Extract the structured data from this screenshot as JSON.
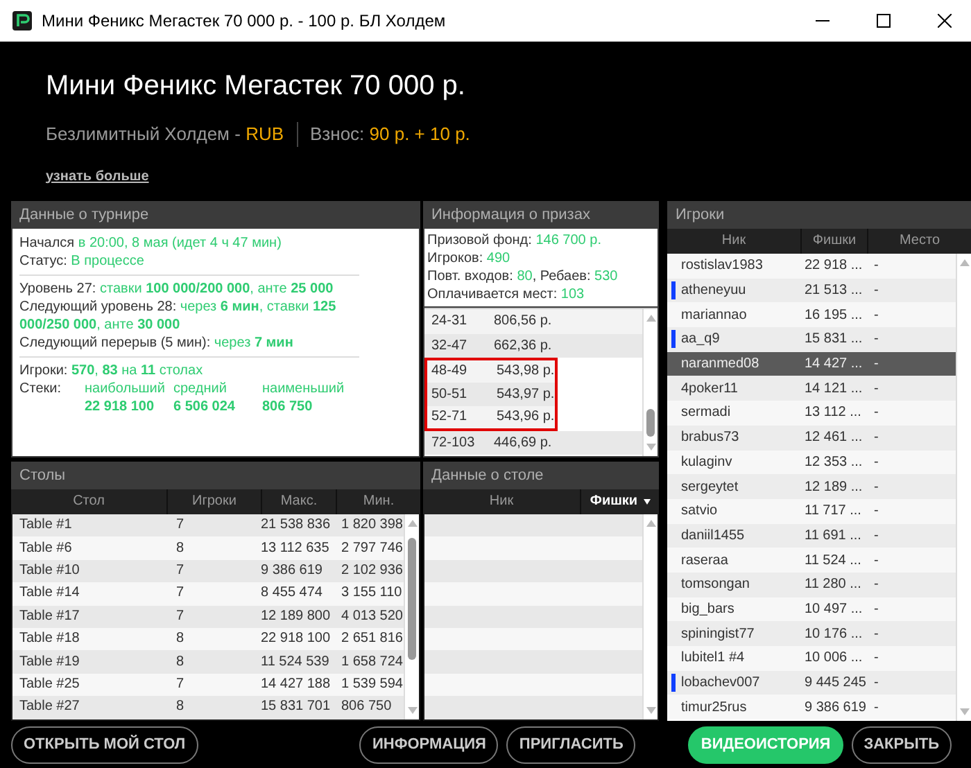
{
  "window": {
    "title": "Мини Феникс Мегастек 70 000 р. - 100 р. БЛ Холдем"
  },
  "header": {
    "title": "Мини Феникс Мегастек 70 000 р.",
    "game": "Безлимитный Холдем - ",
    "currency": "RUB",
    "fee_label": "Взнос: ",
    "fee": "90 р. + 10 р.",
    "more_link": "узнать больше"
  },
  "tournament": {
    "title": "Данные о турнире",
    "groups": [
      [
        {
          "label": "Начался ",
          "value": "в 20:00, 8 мая (идет 4 ч 47 мин)"
        },
        {
          "label": "Статус: ",
          "value": "В процессе"
        }
      ],
      [
        {
          "label": "Уровень 27: ",
          "value": "ставки **100 000/200 000**, анте **25 000**"
        },
        {
          "label": "Следующий уровень 28: ",
          "value": "через **6 мин**, ставки **125 000/250 000**, анте **30 000**"
        },
        {
          "label": "Следующий перерыв (5 мин): ",
          "value": "через **7 мин**"
        }
      ],
      [
        {
          "label": "Игроки: ",
          "value": "**570**, **83** на **11** столах"
        }
      ]
    ],
    "stacks_label": "Стеки:",
    "stacks": [
      {
        "name": "наибольший",
        "value": "22 918 100"
      },
      {
        "name": "средний",
        "value": "6 506 024"
      },
      {
        "name": "наименьший",
        "value": "806 750"
      }
    ]
  },
  "prizes": {
    "title": "Информация о призах",
    "summary": [
      {
        "label": "Призовой фонд: ",
        "value": "146 700 р."
      },
      {
        "label": "Игроков: ",
        "value": "490"
      },
      {
        "parts": [
          {
            "label": "Повт. входов: ",
            "value": "80"
          },
          {
            "label": ", Ребаев: ",
            "value": "530"
          }
        ]
      },
      {
        "label": "Оплачивается мест: ",
        "value": "103"
      }
    ],
    "rows": [
      {
        "places": "24-31",
        "prize": "806,56 р.",
        "highlighted": false
      },
      {
        "places": "32-47",
        "prize": "662,36 р.",
        "highlighted": false
      },
      {
        "places": "48-49",
        "prize": "543,98 р.",
        "highlighted": true
      },
      {
        "places": "50-51",
        "prize": "543,97 р.",
        "highlighted": true
      },
      {
        "places": "52-71",
        "prize": "543,96 р.",
        "highlighted": true
      },
      {
        "places": "72-103",
        "prize": "446,69 р.",
        "highlighted": false
      }
    ]
  },
  "players": {
    "title": "Игроки",
    "columns": [
      "Ник",
      "Фишки",
      "Место"
    ],
    "rows": [
      {
        "nick": "rostislav1983",
        "chips": "22 918 ...",
        "place": "-",
        "marked": false,
        "selected": false
      },
      {
        "nick": "atheneyuu",
        "chips": "21 513 ...",
        "place": "-",
        "marked": true,
        "selected": false
      },
      {
        "nick": "mariannao",
        "chips": "16 195 ...",
        "place": "-",
        "marked": false,
        "selected": false
      },
      {
        "nick": "aa_q9",
        "chips": "15 831 ...",
        "place": "-",
        "marked": true,
        "selected": false
      },
      {
        "nick": "naranmed08",
        "chips": "14 427 ...",
        "place": "-",
        "marked": false,
        "selected": true
      },
      {
        "nick": "4poker11",
        "chips": "14 121 ...",
        "place": "-",
        "marked": false,
        "selected": false
      },
      {
        "nick": "sermadi",
        "chips": "13 112 ...",
        "place": "-",
        "marked": false,
        "selected": false
      },
      {
        "nick": "brabus73",
        "chips": "12 461 ...",
        "place": "-",
        "marked": false,
        "selected": false
      },
      {
        "nick": "kulaginv",
        "chips": "12 353 ...",
        "place": "-",
        "marked": false,
        "selected": false
      },
      {
        "nick": "sergeytet",
        "chips": "12 189 ...",
        "place": "-",
        "marked": false,
        "selected": false
      },
      {
        "nick": "satvio",
        "chips": "11 717 ...",
        "place": "-",
        "marked": false,
        "selected": false
      },
      {
        "nick": "daniil1455",
        "chips": "11 691 ...",
        "place": "-",
        "marked": false,
        "selected": false
      },
      {
        "nick": "raseraa",
        "chips": "11 524 ...",
        "place": "-",
        "marked": false,
        "selected": false
      },
      {
        "nick": "tomsongan",
        "chips": "11 280 ...",
        "place": "-",
        "marked": false,
        "selected": false
      },
      {
        "nick": "big_bars",
        "chips": "10 497 ...",
        "place": "-",
        "marked": false,
        "selected": false
      },
      {
        "nick": "spiningist77",
        "chips": "10 176 ...",
        "place": "-",
        "marked": false,
        "selected": false
      },
      {
        "nick": "lubitel1 #4",
        "chips": "10 006 ...",
        "place": "-",
        "marked": false,
        "selected": false
      },
      {
        "nick": "lobachev007",
        "chips": "9 445 245",
        "place": "-",
        "marked": true,
        "selected": false
      },
      {
        "nick": "timur25rus",
        "chips": "9 386 619",
        "place": "-",
        "marked": false,
        "selected": false
      }
    ]
  },
  "tables": {
    "title": "Столы",
    "columns": [
      "Стол",
      "Игроки",
      "Макс.",
      "Мин."
    ],
    "rows": [
      [
        "Table #1",
        "7",
        "21 538 836",
        "1 820 398"
      ],
      [
        "Table #6",
        "8",
        "13 112 635",
        "2 797 746"
      ],
      [
        "Table #10",
        "7",
        "9 386 619",
        "2 102 936"
      ],
      [
        "Table #14",
        "7",
        "8 455 474",
        "3 155 110"
      ],
      [
        "Table #17",
        "7",
        "12 189 800",
        "4 013 520"
      ],
      [
        "Table #18",
        "8",
        "22 918 100",
        "2 651 816"
      ],
      [
        "Table #19",
        "8",
        "11 524 539",
        "1 658 724"
      ],
      [
        "Table #25",
        "7",
        "14 427 188",
        "1 539 594"
      ],
      [
        "Table #27",
        "8",
        "15 831 701",
        "806 750"
      ]
    ]
  },
  "table_data": {
    "title": "Данные о столе",
    "columns": [
      {
        "label": "Ник",
        "sorted": false
      },
      {
        "label": "Фишки",
        "sorted": true
      }
    ]
  },
  "buttons": [
    {
      "label": "ОТКРЫТЬ МОЙ СТОЛ",
      "kind": "outline"
    },
    {
      "label": "ИНФОРМАЦИЯ",
      "kind": "outline"
    },
    {
      "label": "ПРИГЛАСИТЬ",
      "kind": "outline"
    },
    {
      "label": "ВИДЕОИСТОРИЯ",
      "kind": "primary"
    },
    {
      "label": "ЗАКРЫТЬ",
      "kind": "outline"
    }
  ]
}
